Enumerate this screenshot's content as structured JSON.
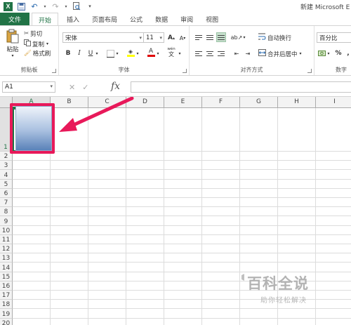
{
  "titlebar": {
    "app_logo": "X",
    "doc_title": "新建 Microsoft E",
    "quick_access": [
      "save-icon",
      "undo-icon",
      "redo-icon",
      "print-preview-icon"
    ]
  },
  "tabs": [
    "文件",
    "开始",
    "插入",
    "页面布局",
    "公式",
    "数据",
    "审阅",
    "视图"
  ],
  "clipboard": {
    "paste": "粘贴",
    "cut": "剪切",
    "copy": "复制",
    "format_painter": "格式刷",
    "group_label": "剪贴板"
  },
  "font": {
    "name": "宋体",
    "size": "11",
    "grow": "A",
    "shrink": "A",
    "bold": "B",
    "italic": "I",
    "underline": "U",
    "font_color_letter": "A",
    "wen": "wén",
    "group_label": "字体"
  },
  "alignment": {
    "wrap_text": "自动换行",
    "merge_center": "合并后居中",
    "group_label": "对齐方式"
  },
  "number": {
    "format": "百分比",
    "percent": "%",
    "comma": ",",
    "group_label": "数字"
  },
  "formula_bar": {
    "name_box": "A1",
    "cancel": "✕",
    "enter": "✓",
    "fx": "fx",
    "value": ""
  },
  "sheet": {
    "columns": [
      "A",
      "B",
      "C",
      "D",
      "E",
      "F",
      "G",
      "H",
      "I"
    ],
    "rows": [
      "1",
      "2",
      "3",
      "4",
      "5",
      "6",
      "7",
      "8",
      "9",
      "10",
      "11",
      "12",
      "13",
      "14",
      "15",
      "16",
      "17",
      "18",
      "19",
      "20"
    ],
    "selected_cell": "A1"
  },
  "watermark": {
    "title": "百科全说",
    "subtitle": "助你轻松解决"
  },
  "colors": {
    "excel_green": "#217346",
    "highlight_pink": "#e8195a",
    "gradient_top": "#eef3fa",
    "gradient_bottom": "#5a82b9"
  }
}
